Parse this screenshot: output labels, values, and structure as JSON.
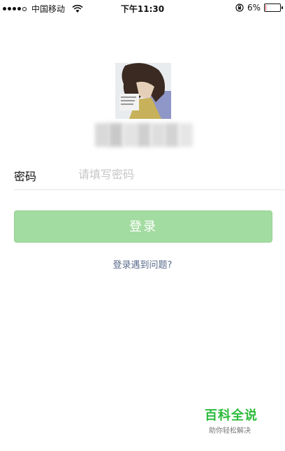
{
  "status_bar": {
    "carrier": "中国移动",
    "time": "下午11:30",
    "battery_pct": "6%",
    "battery_level": 0.06
  },
  "account": {
    "avatar_icon": "user-avatar-image"
  },
  "password": {
    "label": "密码",
    "placeholder": "请填写密码",
    "value": ""
  },
  "login": {
    "button_label": "登录",
    "help_link": "登录遇到问题?"
  },
  "watermark": {
    "title": "百科全说",
    "subtitle": "助你轻松解决"
  },
  "colors": {
    "button_disabled_green": "#a3dca0",
    "link_blue": "#5a6b8c",
    "watermark_green": "#2dbb3b",
    "battery_red": "#e53935"
  }
}
